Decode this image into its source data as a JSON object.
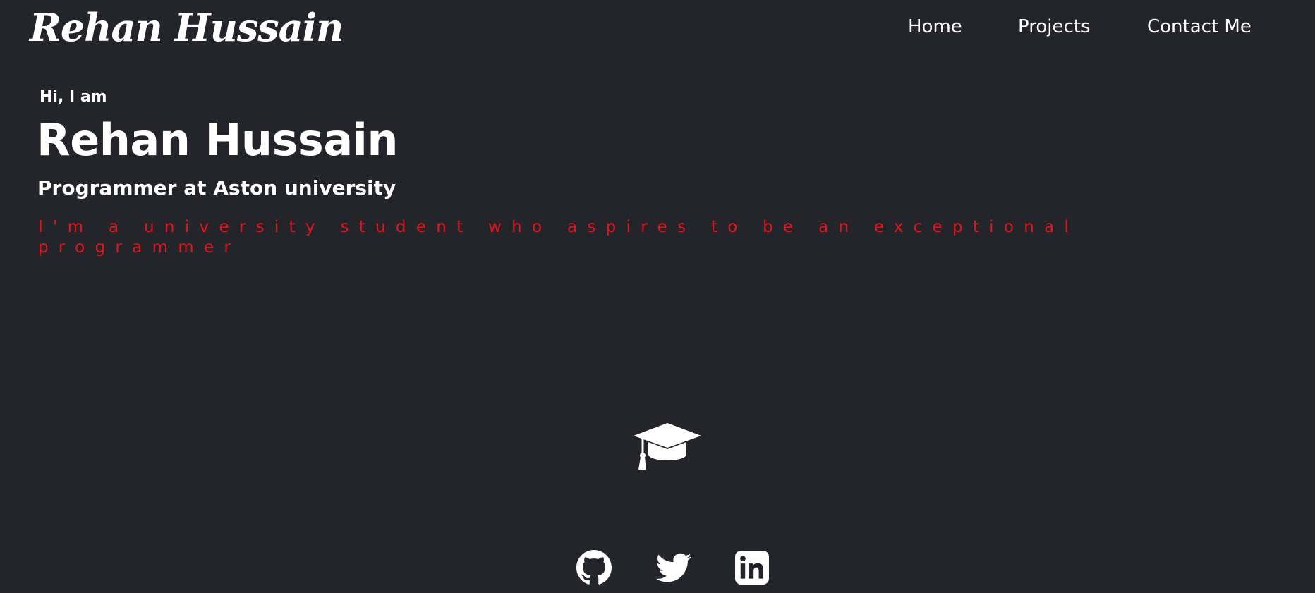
{
  "header": {
    "logo": "Rehan Hussain",
    "nav": [
      "Home",
      "Projects",
      "Contact Me"
    ]
  },
  "hero": {
    "greeting": "Hi, I am",
    "name": "Rehan Hussain",
    "role": "Programmer at Aston university",
    "tagline": "I'm a university student who aspires to be an exceptional programmer"
  },
  "icons": {
    "education": "graduation-cap-icon",
    "social": [
      "github-icon",
      "twitter-icon",
      "linkedin-icon"
    ]
  },
  "colors": {
    "background": "#24252b",
    "text": "#ffffff",
    "accent": "#e0141d"
  }
}
